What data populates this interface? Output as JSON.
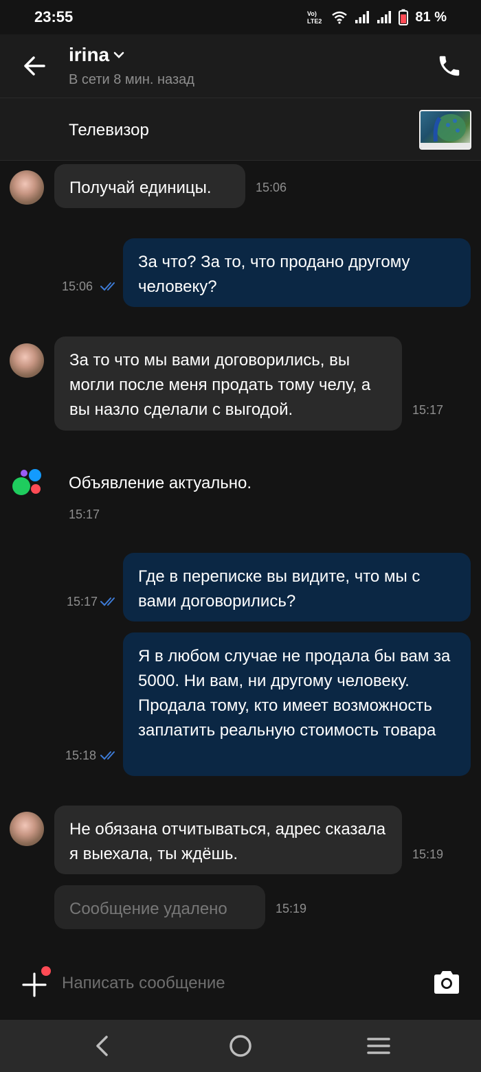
{
  "status_bar": {
    "time": "23:55",
    "network_label": "VoLTE2",
    "battery_percent": "81 %",
    "icons": [
      "volte-icon",
      "wifi-icon",
      "signal-icon",
      "signal-icon",
      "battery-icon"
    ]
  },
  "header": {
    "contact_name": "irina",
    "status": "В сети 8 мин. назад",
    "icons": [
      "back-arrow-icon",
      "chevron-down-icon",
      "phone-icon"
    ]
  },
  "item": {
    "title": "Телевизор",
    "thumbnail_icon": "tv-thumbnail-image"
  },
  "messages": [
    {
      "direction": "in",
      "text": "Получай единицы.",
      "time": "15:06"
    },
    {
      "direction": "out",
      "text": "За что? За то, что продано другому человеку?",
      "time": "15:06",
      "read": true
    },
    {
      "direction": "in",
      "text": "За то что мы вами договорились, вы могли после меня продать тому челу, а вы назло сделали с выгодой.",
      "time": "15:17"
    },
    {
      "direction": "system",
      "text": "Объявление актуально.",
      "time": "15:17"
    },
    {
      "direction": "out",
      "text": "Где в переписке вы видите, что мы с вами договорились?",
      "time": "15:17",
      "read": true
    },
    {
      "direction": "out",
      "text": "Я в любом случае не продала бы вам  за 5000. Ни вам, ни другому человеку.  Продала тому, кто имеет возможность заплатить реальную стоимость товара",
      "time": "15:18",
      "read": true
    },
    {
      "direction": "in",
      "text": "Не обязана отчитываться, адрес сказала я выехала, ты ждёшь.",
      "time": "15:19"
    },
    {
      "direction": "in",
      "deleted": true,
      "text": "Сообщение удалено",
      "time": "15:19"
    }
  ],
  "composer": {
    "placeholder": "Написать сообщение",
    "icons": [
      "plus-icon",
      "camera-icon"
    ]
  },
  "nav": {
    "icons": [
      "nav-back-icon",
      "nav-home-icon",
      "nav-menu-icon"
    ]
  },
  "colors": {
    "background": "#141414",
    "incoming_bubble": "#2a2a2a",
    "outgoing_bubble": "#0b2744",
    "read_tick": "#3d7bd6",
    "secondary_text": "#8e8e8e",
    "notification_dot": "#ff4b55"
  }
}
